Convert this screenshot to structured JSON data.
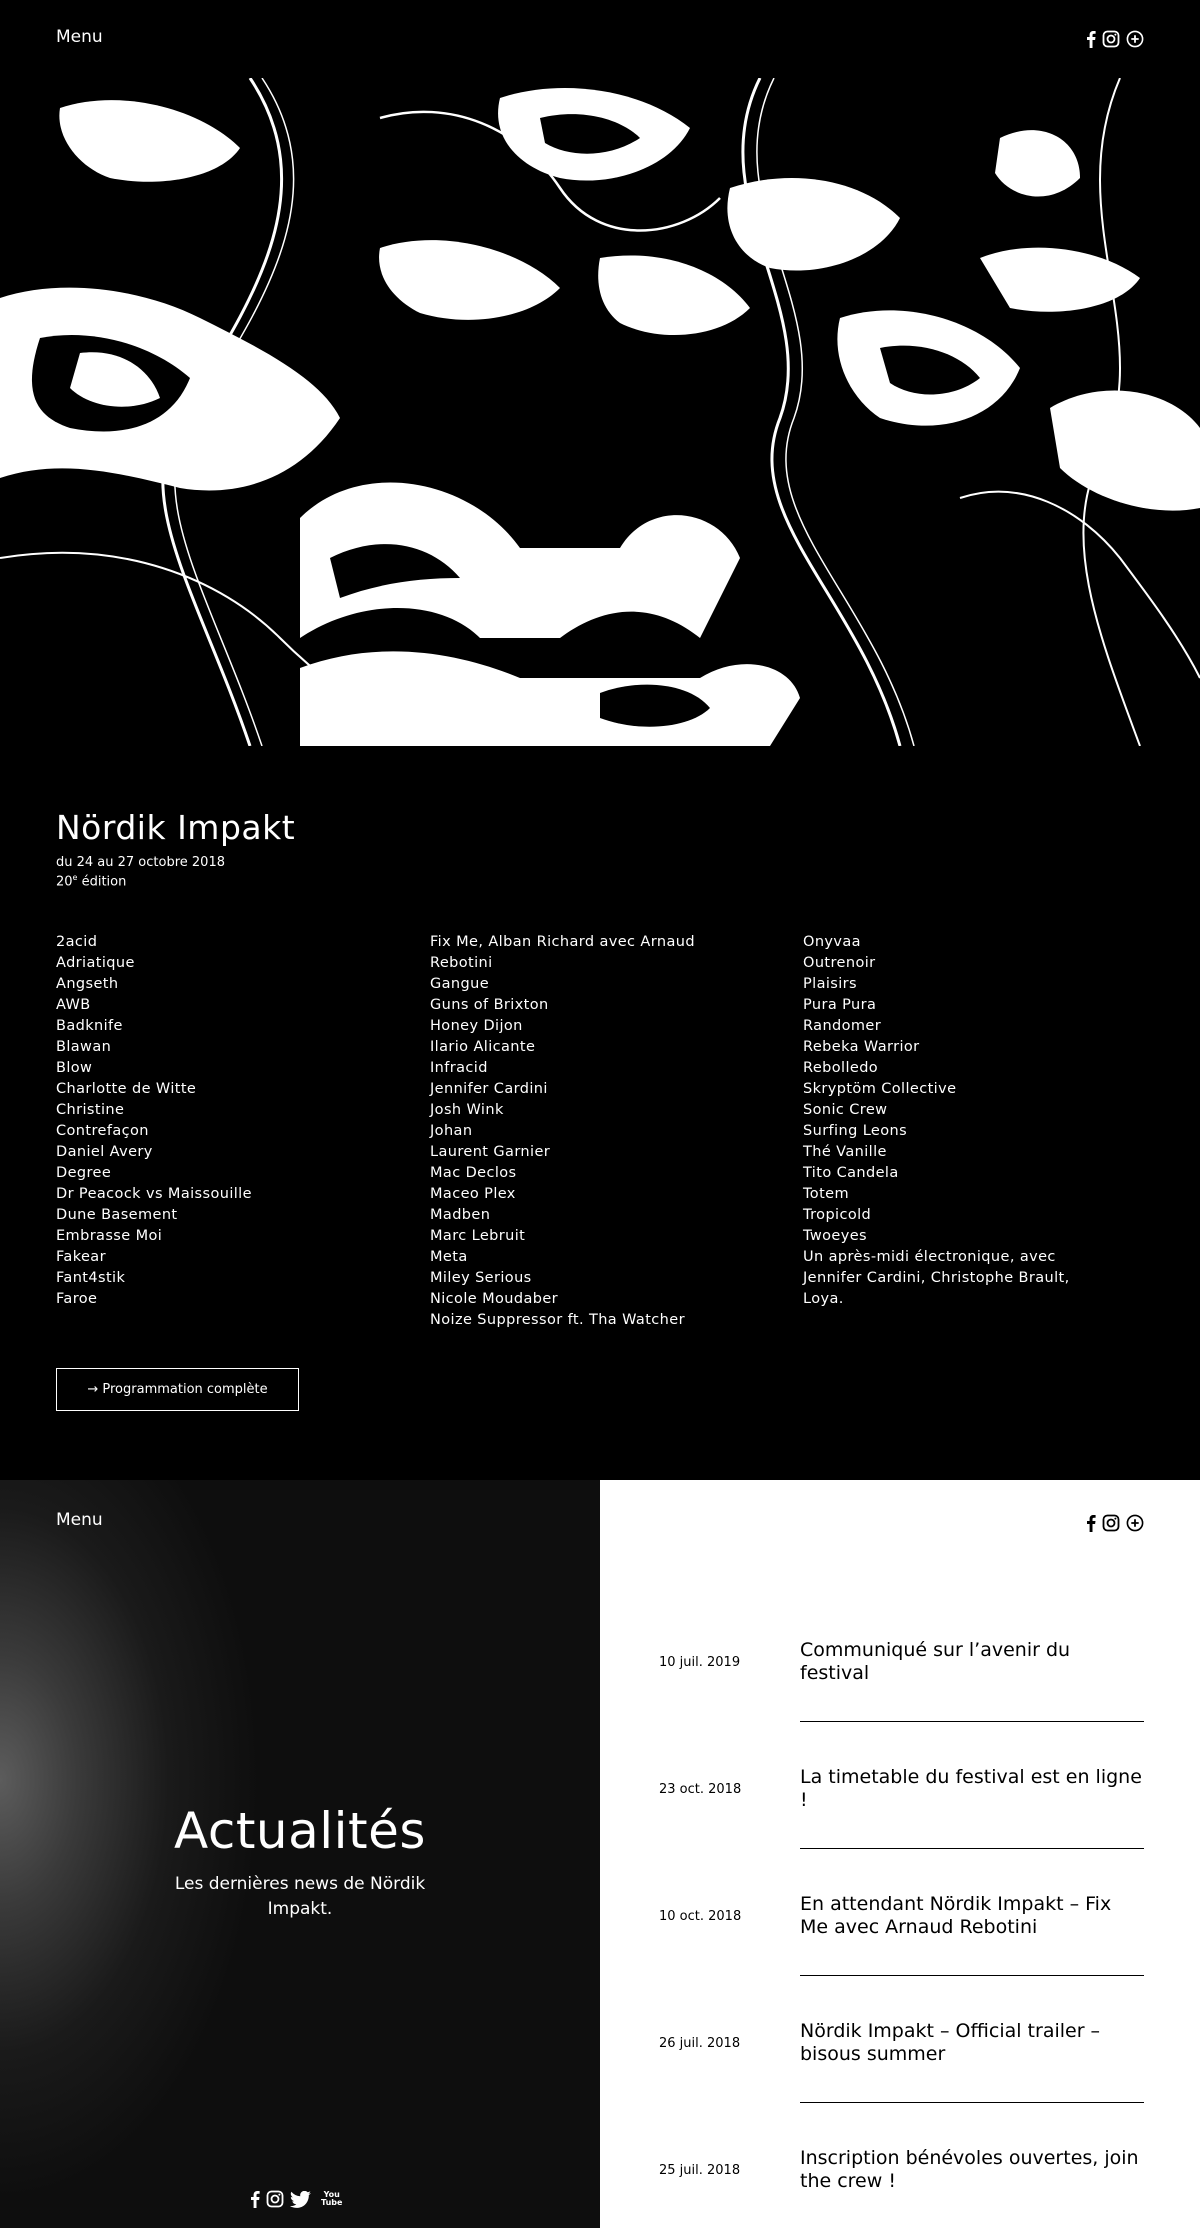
{
  "header": {
    "menu_label": "Menu",
    "social_icons": [
      "facebook-icon",
      "instagram-icon",
      "plus-circle-icon"
    ]
  },
  "festival": {
    "title": "Nördik Impakt",
    "dates": "du 24 au 27 octobre 2018",
    "edition_number": "20",
    "edition_suffix": "e",
    "edition_word": " édition"
  },
  "lineup": {
    "col1": [
      "2acid",
      "Adriatique",
      "Angseth",
      "AWB",
      "Badknife",
      "Blawan",
      "Blow",
      "Charlotte de Witte",
      "Christine",
      "Contrefaçon",
      "Daniel Avery",
      "Degree",
      "Dr Peacock vs Maissouille",
      "Dune Basement",
      "Embrasse Moi",
      "Fakear",
      "Fant4stik",
      "Faroe"
    ],
    "col2": [
      "Fix Me, Alban Richard avec Arnaud",
      "Rebotini",
      "Gangue",
      "Guns of Brixton",
      "Honey Dijon",
      "Ilario Alicante",
      "Infracid",
      "Jennifer Cardini",
      "Josh Wink",
      "Johan",
      "Laurent Garnier",
      "Mac Declos",
      "Maceo Plex",
      "Madben",
      "Marc Lebruit",
      "Meta",
      "Miley Serious",
      "Nicole Moudaber",
      "Noize Suppressor ft. Tha Watcher"
    ],
    "col3": [
      "Onyvaa",
      "Outrenoir",
      "Plaisirs",
      "Pura Pura",
      "Randomer",
      "Rebeka Warrior",
      "Rebolledo",
      "Skryptöm Collective",
      "Sonic Crew",
      "Surfing Leons",
      "Thé Vanille",
      "Tito Candela",
      "Totem",
      "Tropicold",
      "Twoeyes",
      "Un après-midi électronique, avec",
      "Jennifer Cardini, Christophe Brault,",
      "Loya."
    ]
  },
  "program_button": "→ Programmation complète",
  "news": {
    "menu_label": "Menu",
    "heading": "Actualités",
    "subheading": "Les dernières news de Nördik Impakt.",
    "footer_social": [
      "facebook-icon",
      "instagram-icon",
      "twitter-icon",
      "youtube-icon"
    ],
    "youtube_text_1": "You",
    "youtube_text_2": "Tube",
    "items": [
      {
        "date": "10 juil. 2019",
        "title": "Communiqué sur l’avenir du festival"
      },
      {
        "date": "23 oct. 2018",
        "title": "La timetable du festival est en ligne !"
      },
      {
        "date": "10 oct. 2018",
        "title": "En attendant Nördik Impakt – Fix Me avec Arnaud Rebotini"
      },
      {
        "date": "26 juil. 2018",
        "title": "Nördik Impakt – Official trailer – bisous summer"
      },
      {
        "date": "25 juil. 2018",
        "title": "Inscription bénévoles ouvertes, join the crew !"
      }
    ]
  },
  "colors": {
    "background": "#000000",
    "text_light": "#ffffff",
    "panel_light": "#ffffff",
    "text_dark": "#000000"
  }
}
